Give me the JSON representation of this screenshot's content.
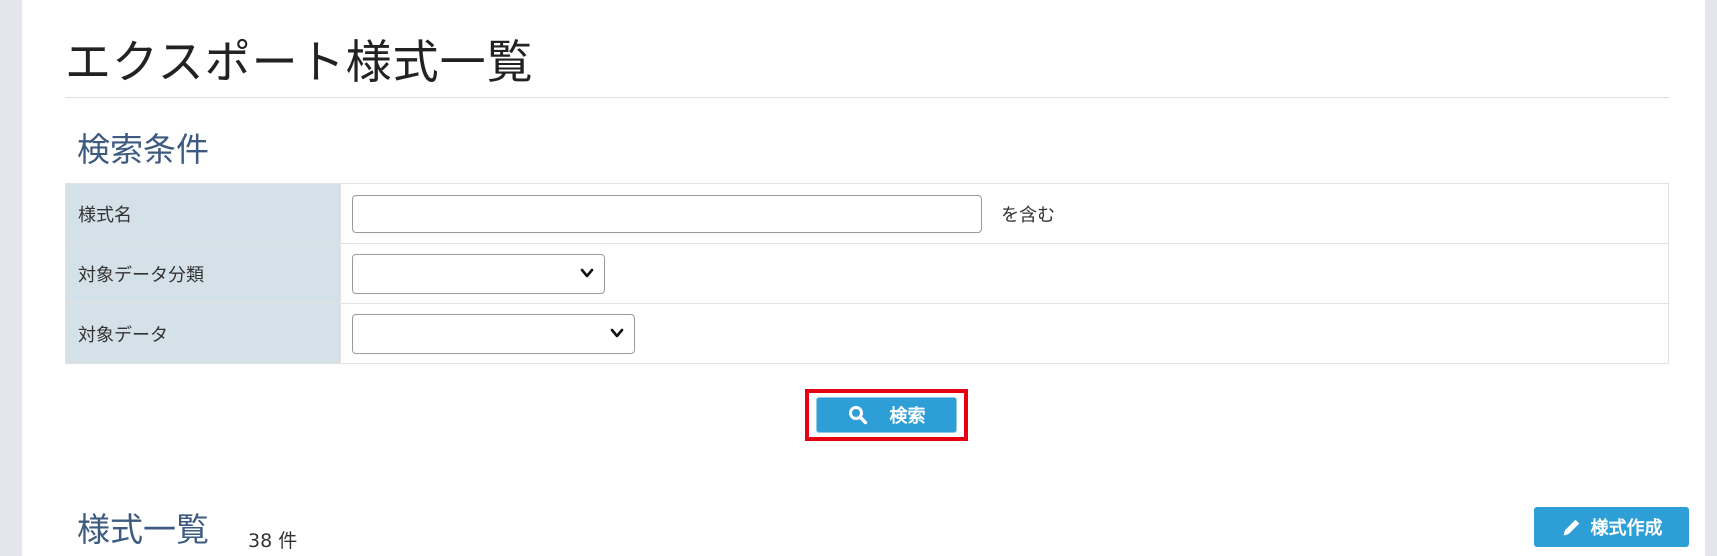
{
  "page": {
    "title": "エクスポート様式一覧"
  },
  "search_section": {
    "title": "検索条件",
    "fields": [
      {
        "label": "様式名",
        "value": "",
        "suffix": "を含む"
      },
      {
        "label": "対象データ分類",
        "value": ""
      },
      {
        "label": "対象データ",
        "value": ""
      }
    ],
    "search_button": {
      "label": "検索",
      "icon": "search-icon"
    }
  },
  "list_section": {
    "title": "様式一覧",
    "count": "38 件",
    "create_button": {
      "label": "様式作成",
      "icon": "pencil-icon"
    }
  },
  "colors": {
    "button": "#2e9fd6",
    "label_bg": "#d5e1e9",
    "section_title": "#3d5a80",
    "highlight": "#e60012"
  }
}
